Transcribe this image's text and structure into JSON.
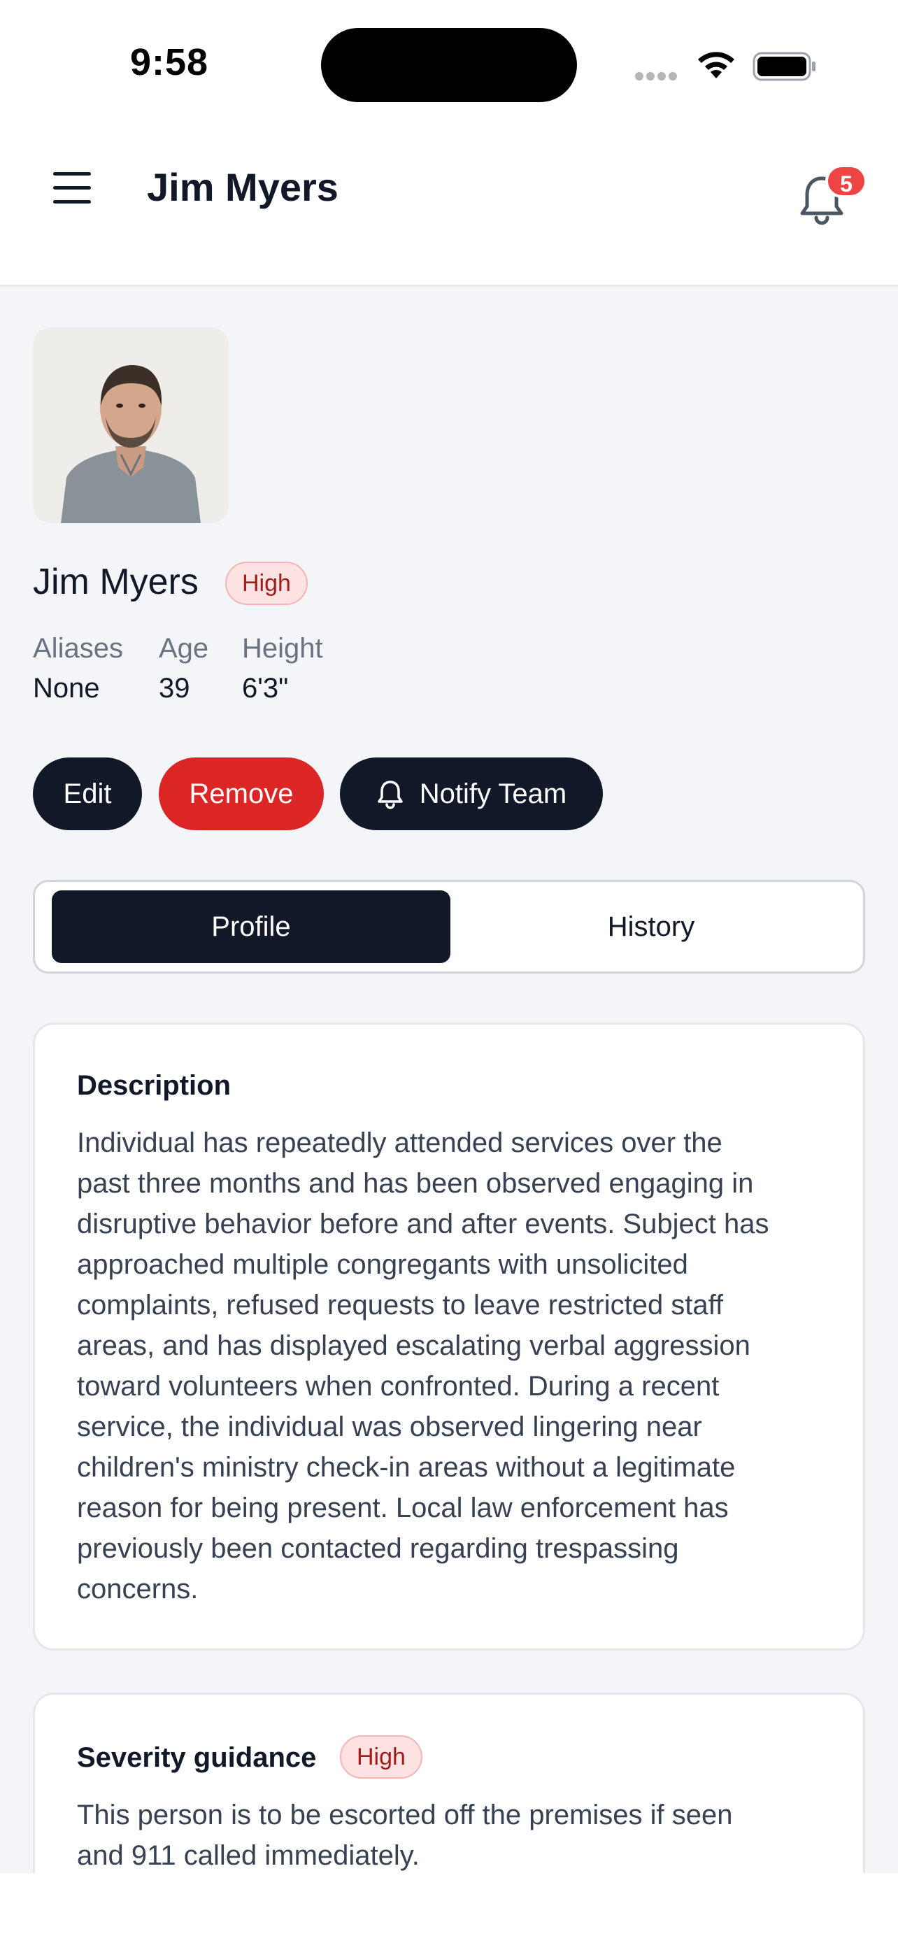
{
  "status_bar": {
    "time": "9:58"
  },
  "header": {
    "title": "Jim Myers",
    "notification_count": "5"
  },
  "person": {
    "name": "Jim Myers",
    "severity_badge": "High",
    "details": [
      {
        "label": "Aliases",
        "value": "None"
      },
      {
        "label": "Age",
        "value": "39"
      },
      {
        "label": "Height",
        "value": "6'3\""
      }
    ]
  },
  "actions": {
    "edit": "Edit",
    "remove": "Remove",
    "notify": "Notify Team"
  },
  "tabs": [
    {
      "label": "Profile",
      "active": true
    },
    {
      "label": "History",
      "active": false
    }
  ],
  "description": {
    "title": "Description",
    "lines": [
      "Individual has repeatedly attended services over the",
      "past three months and has been observed engaging in",
      "disruptive behavior before and after events. Subject has",
      "approached multiple congregants with unsolicited",
      "complaints, refused requests to leave restricted staff",
      "areas, and has displayed escalating verbal aggression",
      "toward volunteers when confronted. During a recent",
      "service, the individual was observed lingering near",
      "children's ministry check-in areas without a legitimate",
      "reason for being present. Local law enforcement has",
      "previously been contacted regarding trespassing",
      "concerns."
    ]
  },
  "severity_guidance": {
    "title": "Severity guidance",
    "badge": "High",
    "lines": [
      "This person is to be escorted off the premises if seen",
      "and 911 called immediately."
    ]
  },
  "colors": {
    "primary_dark": "#111827",
    "danger": "#dc2626",
    "badge_bg": "#fde2e2",
    "badge_text": "#a11c1c",
    "page_bg": "#f3f5f9"
  }
}
